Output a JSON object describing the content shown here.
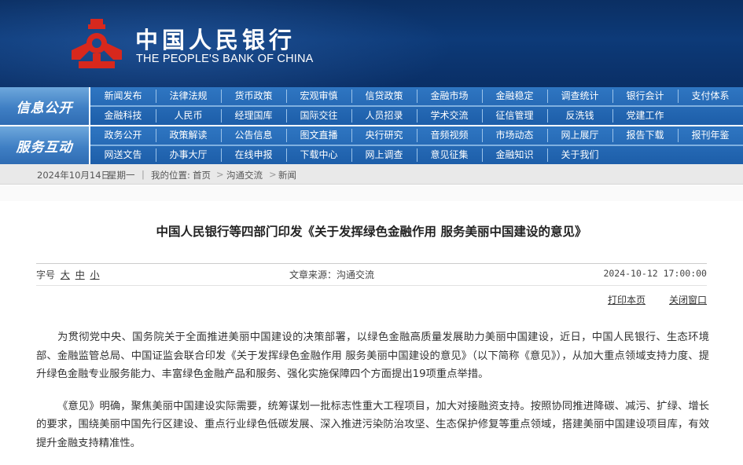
{
  "header": {
    "name_cn": "中国人民银行",
    "name_en": "THE PEOPLE'S BANK OF CHINA",
    "emblem_icon": "pboc-emblem-icon",
    "colors": {
      "header_bg": "#0d3a78",
      "emblem": "#d7281d",
      "nav_bg": "#1d5ea9"
    }
  },
  "nav": {
    "info": {
      "label": "信息公开",
      "row1": [
        "新闻发布",
        "法律法规",
        "货币政策",
        "宏观审慎",
        "信贷政策",
        "金融市场",
        "金融稳定",
        "调查统计",
        "银行会计",
        "支付体系"
      ],
      "row2": [
        "金融科技",
        "人民币",
        "经理国库",
        "国际交往",
        "人员招录",
        "学术交流",
        "征信管理",
        "反洗钱",
        "党建工作"
      ]
    },
    "interact": {
      "label": "服务互动",
      "row1": [
        "政务公开",
        "政策解读",
        "公告信息",
        "图文直播",
        "央行研究",
        "音频视频",
        "市场动态",
        "网上展厅",
        "报告下载",
        "报刊年鉴"
      ],
      "row2": [
        "网送文告",
        "办事大厅",
        "在线申报",
        "下载中心",
        "网上调查",
        "意见征集",
        "金融知识",
        "关于我们"
      ]
    }
  },
  "breadcrumb": {
    "date": "2024年10月14日",
    "weekday": "星期一",
    "location_label": "我的位置:",
    "items": [
      "首页",
      "沟通交流",
      "新闻"
    ],
    "separator": ">"
  },
  "article": {
    "title": "中国人民银行等四部门印发《关于发挥绿色金融作用 服务美丽中国建设的意见》",
    "font_size_label": "字号",
    "font_sizes": [
      "大",
      "中",
      "小"
    ],
    "source_label": "文章来源：",
    "source": "沟通交流",
    "datetime": "2024-10-12 17:00:00",
    "print_label": "打印本页",
    "close_label": "关闭窗口",
    "paragraphs": [
      "为贯彻党中央、国务院关于全面推进美丽中国建设的决策部署，以绿色金融高质量发展助力美丽中国建设，近日，中国人民银行、生态环境部、金融监管总局、中国证监会联合印发《关于发挥绿色金融作用 服务美丽中国建设的意见》（以下简称《意见》），从加大重点领域支持力度、提升绿色金融专业服务能力、丰富绿色金融产品和服务、强化实施保障四个方面提出19项重点举措。",
      "《意见》明确，聚焦美丽中国建设实际需要，统筹谋划一批标志性重大工程项目，加大对接融资支持。按照协同推进降碳、减污、扩绿、增长的要求，围绕美丽中国先行区建设、重点行业绿色低碳发展、深入推进污染防治攻坚、生态保护修复等重点领域，搭建美丽中国建设项目库，有效提升金融支持精准性。"
    ]
  }
}
